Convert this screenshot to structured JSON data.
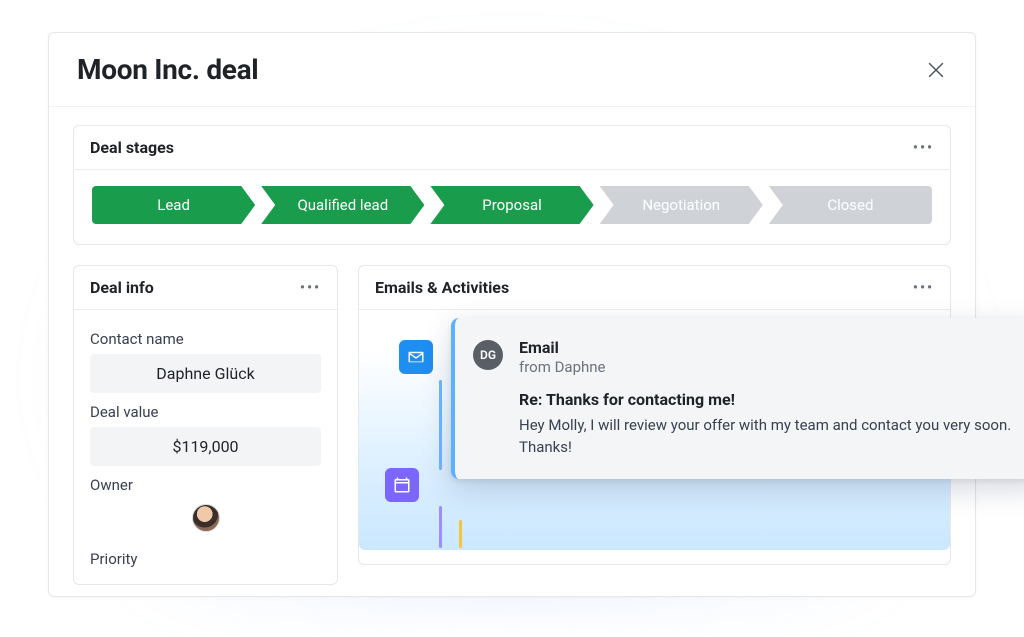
{
  "header": {
    "title": "Moon Inc. deal"
  },
  "stages": {
    "title": "Deal stages",
    "items": [
      {
        "label": "Lead",
        "active": true
      },
      {
        "label": "Qualified lead",
        "active": true
      },
      {
        "label": "Proposal",
        "active": true
      },
      {
        "label": "Negotiation",
        "active": false
      },
      {
        "label": "Closed",
        "active": false
      }
    ]
  },
  "deal_info": {
    "title": "Deal info",
    "contact_label": "Contact name",
    "contact_value": "Daphne Glück",
    "value_label": "Deal value",
    "value_value": "$119,000",
    "owner_label": "Owner",
    "priority_label": "Priority"
  },
  "activities": {
    "title": "Emails & Activities",
    "email": {
      "avatar_initials": "DG",
      "type_label": "Email",
      "from_label": "from Daphne",
      "subject": "Re: Thanks for contacting me!",
      "body": "Hey Molly, I will review your offer with my team and contact you very soon. Thanks!"
    }
  }
}
